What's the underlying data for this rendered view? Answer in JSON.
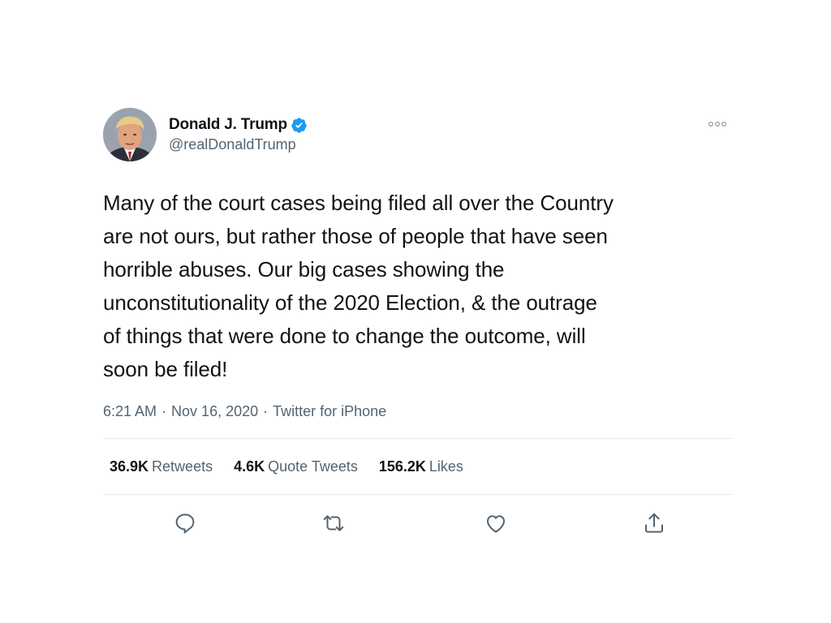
{
  "author": {
    "display_name": "Donald J. Trump",
    "handle": "@realDonaldTrump",
    "verified": true,
    "avatar_icon": "profile-photo"
  },
  "tweet": {
    "text": "Many of the court cases being filed all over the Country\nare not ours, but rather those of people that have seen\nhorrible abuses. Our big cases showing the\nunconstitutionality of the 2020 Election, & the outrage\nof things that were done to change the outcome, will\nsoon be filed!",
    "time": "6:21 AM",
    "date": "Nov 16, 2020",
    "separator": "·",
    "source": "Twitter for iPhone"
  },
  "stats": {
    "retweets_count": "36.9K",
    "retweets_label": "Retweets",
    "quotes_count": "4.6K",
    "quotes_label": "Quote Tweets",
    "likes_count": "156.2K",
    "likes_label": "Likes"
  },
  "actions": {
    "reply_icon": "reply-icon",
    "retweet_icon": "retweet-icon",
    "like_icon": "heart-icon",
    "share_icon": "share-icon"
  },
  "colors": {
    "text_primary": "#0f1419",
    "text_secondary": "#536471",
    "verified_blue": "#1d9bf0",
    "divider": "#e6ecf0",
    "icon_gray": "#536471"
  }
}
